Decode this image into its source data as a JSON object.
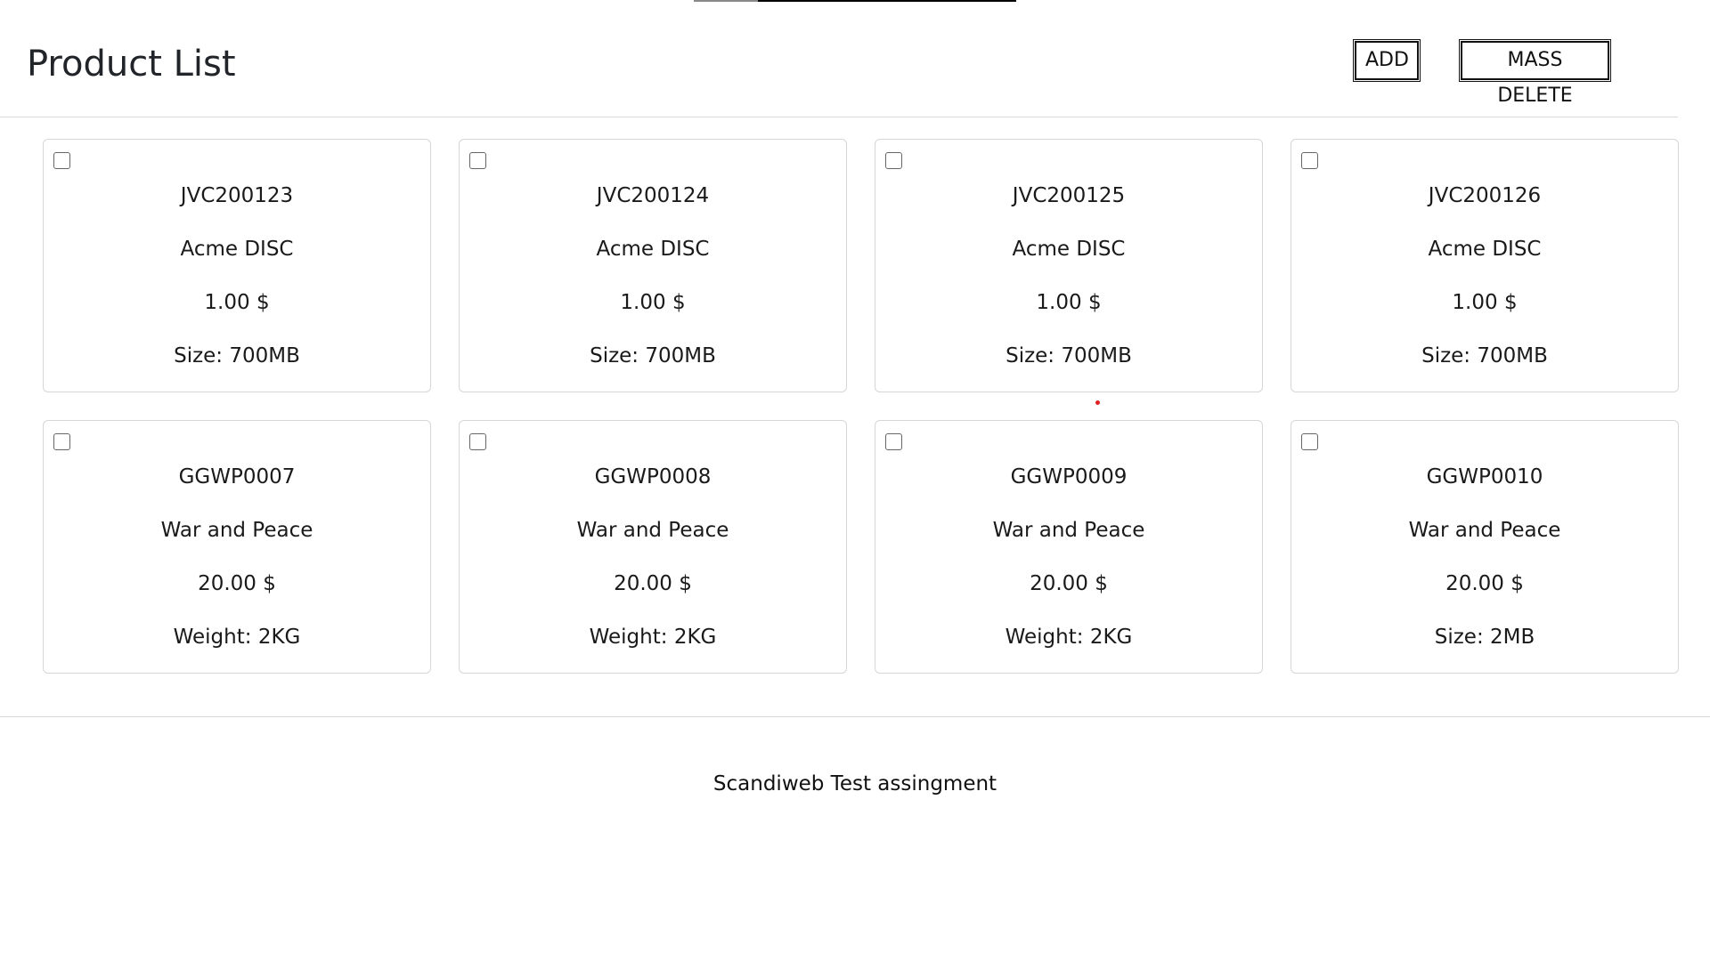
{
  "header": {
    "title": "Product List",
    "add_label": "ADD",
    "mass_delete_label": "MASS DELETE"
  },
  "products": [
    {
      "sku": "JVC200123",
      "name": "Acme DISC",
      "price": "1.00 $",
      "attribute": "Size: 700MB",
      "checked": false
    },
    {
      "sku": "JVC200124",
      "name": "Acme DISC",
      "price": "1.00 $",
      "attribute": "Size: 700MB",
      "checked": false
    },
    {
      "sku": "JVC200125",
      "name": "Acme DISC",
      "price": "1.00 $",
      "attribute": "Size: 700MB",
      "checked": false
    },
    {
      "sku": "JVC200126",
      "name": "Acme DISC",
      "price": "1.00 $",
      "attribute": "Size: 700MB",
      "checked": false
    },
    {
      "sku": "GGWP0007",
      "name": "War and Peace",
      "price": "20.00 $",
      "attribute": "Weight: 2KG",
      "checked": false
    },
    {
      "sku": "GGWP0008",
      "name": "War and Peace",
      "price": "20.00 $",
      "attribute": "Weight: 2KG",
      "checked": false
    },
    {
      "sku": "GGWP0009",
      "name": "War and Peace",
      "price": "20.00 $",
      "attribute": "Weight: 2KG",
      "checked": false
    },
    {
      "sku": "GGWP0010",
      "name": "War and Peace",
      "price": "20.00 $",
      "attribute": "Size: 2MB",
      "checked": false
    }
  ],
  "footer": {
    "text": "Scandiweb Test assingment"
  }
}
